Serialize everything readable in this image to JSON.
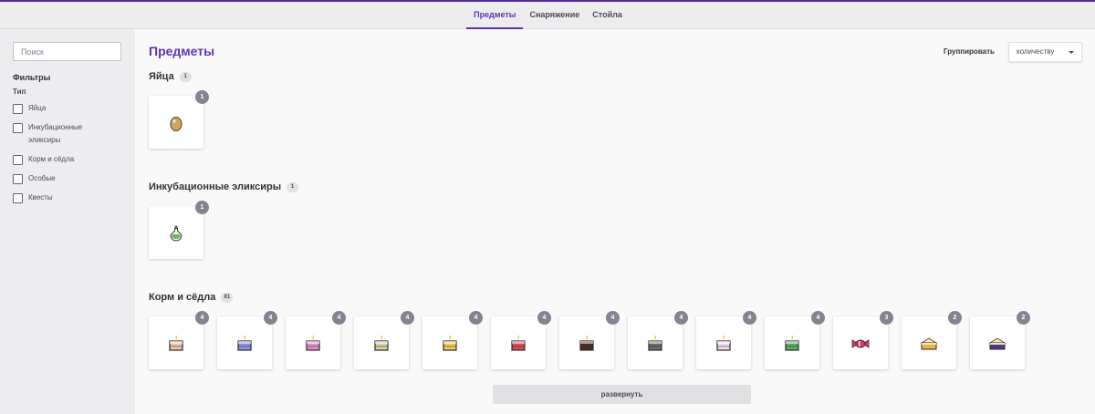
{
  "nav": {
    "tabs": [
      {
        "label": "Предметы",
        "active": true
      },
      {
        "label": "Снаряжение",
        "active": false
      },
      {
        "label": "Стойла",
        "active": false
      }
    ]
  },
  "sidebar": {
    "search_placeholder": "Поиск",
    "filters_title": "Фильтры",
    "type_title": "Тип",
    "filters": [
      {
        "label": "Яйца",
        "checked": false
      },
      {
        "label": "Инкубационные эликсиры",
        "checked": false
      },
      {
        "label": "Корм и сёдла",
        "checked": false
      },
      {
        "label": "Особые",
        "checked": false
      },
      {
        "label": "Квесты",
        "checked": false
      }
    ]
  },
  "main": {
    "title": "Предметы",
    "group_label": "Группировать",
    "group_value": "количеству",
    "expand_label": "развернуть",
    "sections": [
      {
        "title": "Яйца",
        "count": "1",
        "items": [
          {
            "icon": "egg-icon",
            "quantity": "1",
            "color": "#c9a766"
          }
        ]
      },
      {
        "title": "Инкубационные эликсиры",
        "count": "1",
        "items": [
          {
            "icon": "potion-icon",
            "quantity": "1",
            "color": "#6bb84c"
          }
        ]
      },
      {
        "title": "Корм и сёдла",
        "count": "81",
        "items": [
          {
            "icon": "cake-icon",
            "quantity": "4",
            "color": "#e8c9a7"
          },
          {
            "icon": "cake-icon",
            "quantity": "4",
            "color": "#8f8fe3"
          },
          {
            "icon": "cake-icon",
            "quantity": "4",
            "color": "#e58fd0"
          },
          {
            "icon": "cake-icon",
            "quantity": "4",
            "color": "#d8d3a4"
          },
          {
            "icon": "cake-icon",
            "quantity": "4",
            "color": "#f2c95b"
          },
          {
            "icon": "cake-icon",
            "quantity": "4",
            "color": "#d94b58"
          },
          {
            "icon": "cake-icon",
            "quantity": "4",
            "color": "#4a2c22"
          },
          {
            "icon": "cake-icon",
            "quantity": "4",
            "color": "#6c6c6c"
          },
          {
            "icon": "cake-icon",
            "quantity": "4",
            "color": "#f1dcea"
          },
          {
            "icon": "cake-icon",
            "quantity": "4",
            "color": "#5aa866"
          },
          {
            "icon": "candy-icon",
            "quantity": "3",
            "color": "#c93f66"
          },
          {
            "icon": "pie-icon",
            "quantity": "2",
            "color": "#e8b24e"
          },
          {
            "icon": "pie-icon",
            "quantity": "2",
            "color": "#4a3a8c"
          }
        ]
      }
    ]
  }
}
